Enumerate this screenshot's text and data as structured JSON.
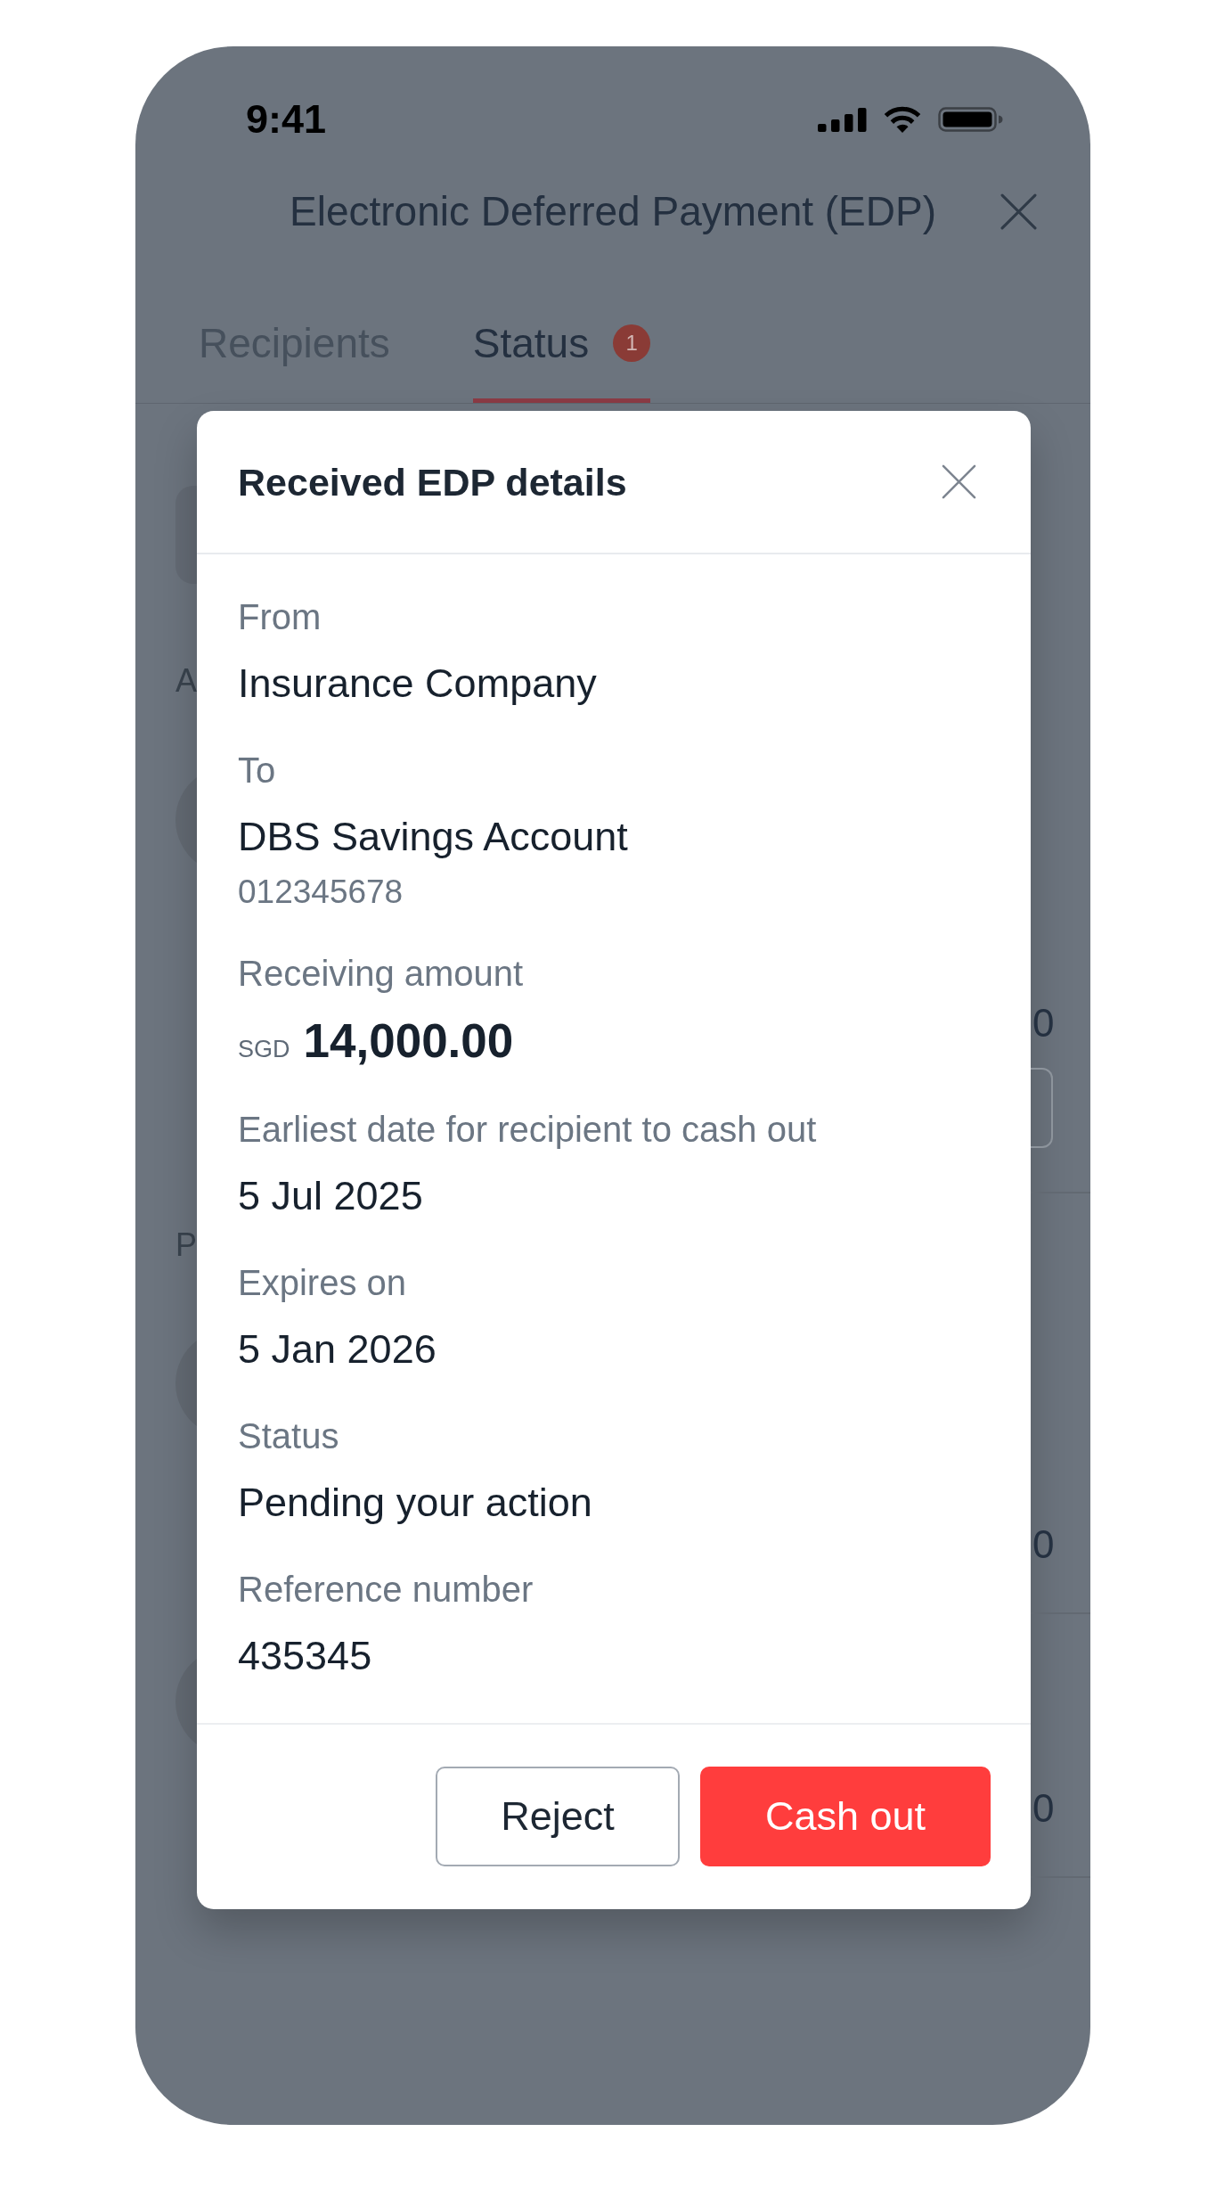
{
  "status_bar": {
    "time": "9:41"
  },
  "header": {
    "title": "Electronic Deferred Payment (EDP)"
  },
  "tabs": [
    {
      "label": "Recipients",
      "selected": false
    },
    {
      "label": "Status",
      "selected": true,
      "badge": "1"
    }
  ],
  "background": {
    "section_headings": [
      "A",
      "P"
    ],
    "amounts": [
      "0",
      "0",
      "0"
    ]
  },
  "dialog": {
    "title": "Received EDP details",
    "fields": [
      {
        "kind": "text",
        "label": "From",
        "value": "Insurance Company"
      },
      {
        "kind": "text",
        "label": "To",
        "value": "DBS Savings Account",
        "detail": "012345678"
      },
      {
        "kind": "amount",
        "label": "Receiving amount",
        "currency": "SGD",
        "value": "14,000.00"
      },
      {
        "kind": "text",
        "label": "Earliest date for recipient to cash out",
        "value": "5 Jul 2025"
      },
      {
        "kind": "text",
        "label": "Expires on",
        "value": "5 Jan 2026"
      },
      {
        "kind": "text",
        "label": "Status",
        "value": "Pending your action"
      },
      {
        "kind": "text",
        "label": "Reference number",
        "value": "435345"
      }
    ],
    "buttons": [
      {
        "kind": "secondary",
        "label": "Reject"
      },
      {
        "kind": "primary",
        "label": "Cash out"
      }
    ]
  }
}
